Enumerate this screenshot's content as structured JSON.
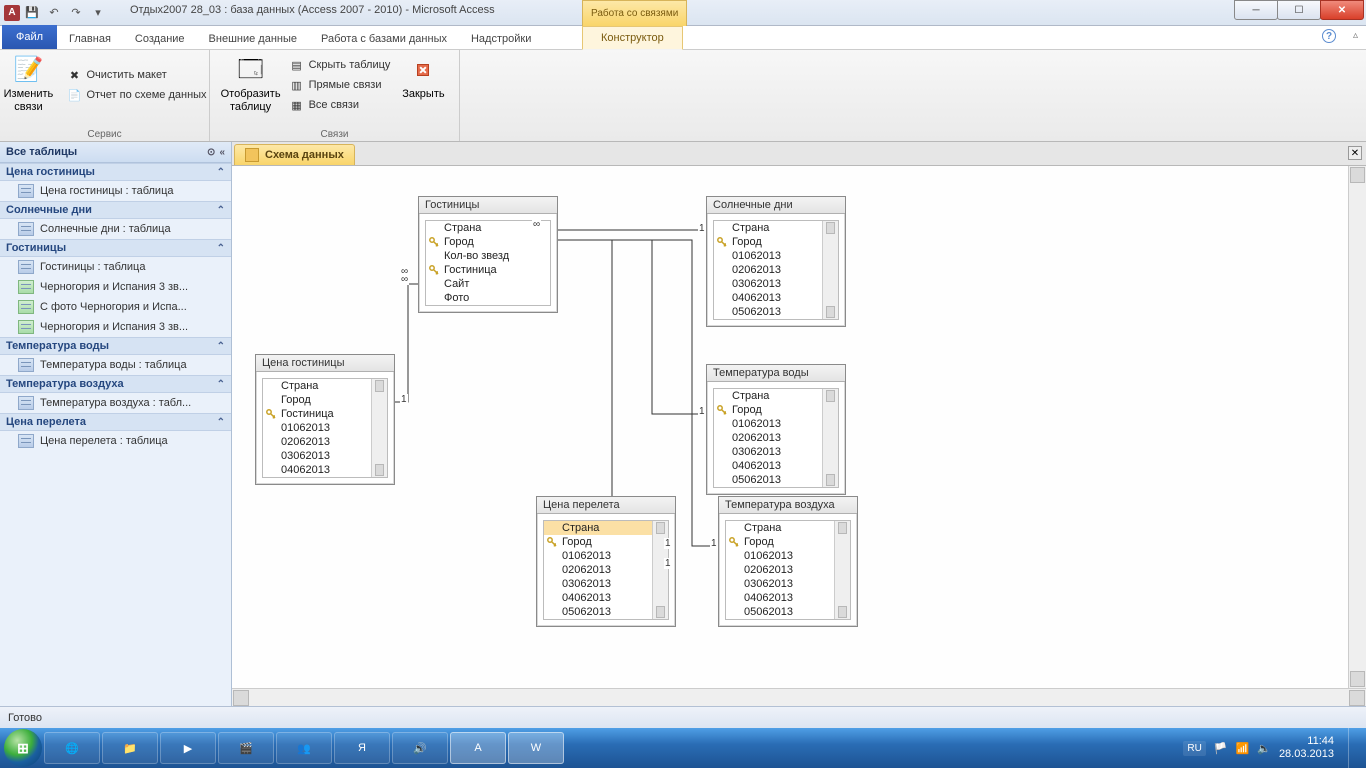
{
  "title": "Отдых2007 28_03 : база данных (Access 2007 - 2010)  -  Microsoft Access",
  "contextual_tab_group": "Работа со связями",
  "ribbon_tabs": {
    "file": "Файл",
    "t0": "Главная",
    "t1": "Создание",
    "t2": "Внешние данные",
    "t3": "Работа с базами данных",
    "t4": "Надстройки",
    "t5": "Конструктор"
  },
  "ribbon": {
    "grp_service": "Сервис",
    "grp_relations": "Связи",
    "btn_edit_relations": "Изменить\nсвязи",
    "btn_clear_layout": "Очистить макет",
    "btn_relation_report": "Отчет по схеме данных",
    "btn_show_table": "Отобразить\nтаблицу",
    "btn_hide_table": "Скрыть таблицу",
    "btn_direct_relations": "Прямые связи",
    "btn_all_relations": "Все связи",
    "btn_close": "Закрыть"
  },
  "nav": {
    "header": "Все таблицы",
    "groups": [
      {
        "title": "Цена гостиницы",
        "items": [
          {
            "label": "Цена гостиницы : таблица",
            "type": "t"
          }
        ]
      },
      {
        "title": "Солнечные дни",
        "items": [
          {
            "label": "Солнечные дни : таблица",
            "type": "t"
          }
        ]
      },
      {
        "title": "Гостиницы",
        "items": [
          {
            "label": "Гостиницы : таблица",
            "type": "t"
          },
          {
            "label": "Черногория и Испания 3 зв...",
            "type": "q"
          },
          {
            "label": "С фото Черногория и Испа...",
            "type": "q"
          },
          {
            "label": "Черногория и Испания 3 зв...",
            "type": "q"
          }
        ]
      },
      {
        "title": "Температура воды",
        "items": [
          {
            "label": "Температура воды : таблица",
            "type": "t"
          }
        ]
      },
      {
        "title": "Температура воздуха",
        "items": [
          {
            "label": "Температура воздуха : табл...",
            "type": "t"
          }
        ]
      },
      {
        "title": "Цена перелета",
        "items": [
          {
            "label": "Цена перелета : таблица",
            "type": "t"
          }
        ]
      }
    ]
  },
  "document_tab": "Схема данных",
  "tables": {
    "hotels": {
      "title": "Гостиницы",
      "fields": [
        {
          "n": "Страна"
        },
        {
          "n": "Город",
          "k": true
        },
        {
          "n": "Кол-во звезд"
        },
        {
          "n": "Гостиница",
          "k": true
        },
        {
          "n": "Сайт"
        },
        {
          "n": "Фото"
        }
      ]
    },
    "sunny": {
      "title": "Солнечные дни",
      "fields": [
        {
          "n": "Страна"
        },
        {
          "n": "Город",
          "k": true
        },
        {
          "n": "01062013"
        },
        {
          "n": "02062013"
        },
        {
          "n": "03062013"
        },
        {
          "n": "04062013"
        },
        {
          "n": "05062013"
        }
      ]
    },
    "price_hotel": {
      "title": "Цена гостиницы",
      "fields": [
        {
          "n": "Страна"
        },
        {
          "n": "Город"
        },
        {
          "n": "Гостиница",
          "k": true
        },
        {
          "n": "01062013"
        },
        {
          "n": "02062013"
        },
        {
          "n": "03062013"
        },
        {
          "n": "04062013"
        }
      ]
    },
    "water": {
      "title": "Температура воды",
      "fields": [
        {
          "n": "Страна"
        },
        {
          "n": "Город",
          "k": true
        },
        {
          "n": "01062013"
        },
        {
          "n": "02062013"
        },
        {
          "n": "03062013"
        },
        {
          "n": "04062013"
        },
        {
          "n": "05062013"
        }
      ]
    },
    "flight": {
      "title": "Цена перелета",
      "fields": [
        {
          "n": "Страна",
          "sel": true
        },
        {
          "n": "Город",
          "k": true
        },
        {
          "n": "01062013"
        },
        {
          "n": "02062013"
        },
        {
          "n": "03062013"
        },
        {
          "n": "04062013"
        },
        {
          "n": "05062013"
        }
      ]
    },
    "air": {
      "title": "Температура воздуха",
      "fields": [
        {
          "n": "Страна"
        },
        {
          "n": "Город",
          "k": true
        },
        {
          "n": "01062013"
        },
        {
          "n": "02062013"
        },
        {
          "n": "03062013"
        },
        {
          "n": "04062013"
        },
        {
          "n": "05062013"
        }
      ]
    }
  },
  "rel_labels": {
    "one": "1",
    "many": "∞"
  },
  "status": "Готово",
  "tray": {
    "lang": "RU",
    "time": "11:44",
    "date": "28.03.2013"
  }
}
